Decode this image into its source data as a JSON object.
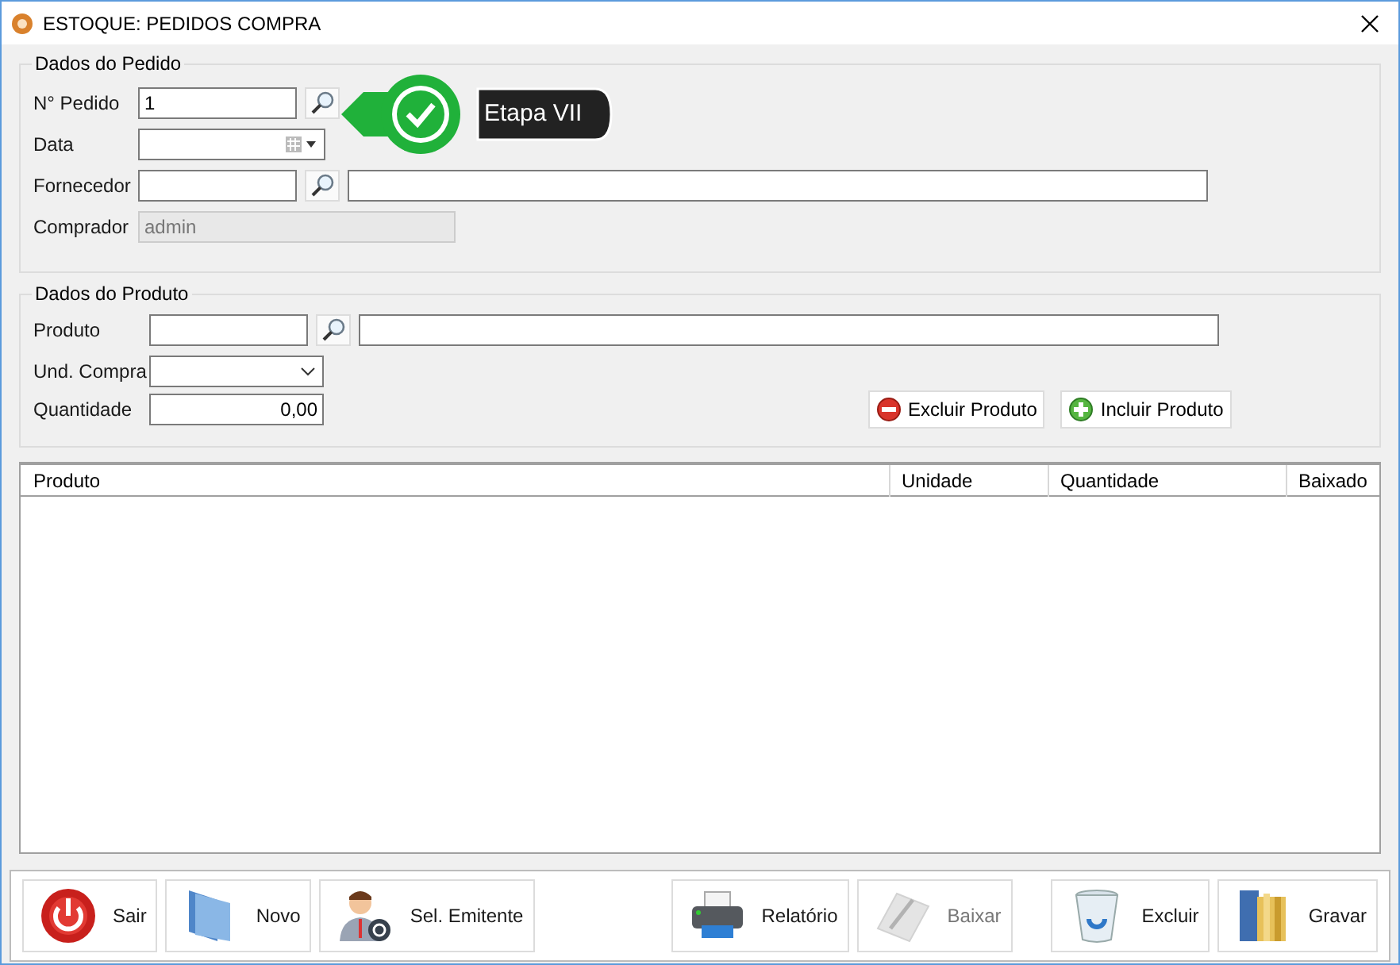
{
  "window": {
    "title": "ESTOQUE: PEDIDOS COMPRA"
  },
  "pedido": {
    "legend": "Dados do Pedido",
    "fields": [
      {
        "label": "N° Pedido",
        "kind": "lookup",
        "value": "1",
        "disabled": false
      },
      {
        "label": "Data",
        "kind": "date",
        "disabled": false
      },
      {
        "label": "Fornecedor",
        "kind": "lookup_desc",
        "disabled": false
      },
      {
        "label": "Comprador",
        "kind": "text",
        "value": "admin",
        "disabled": true
      }
    ]
  },
  "produto": {
    "legend": "Dados do Produto",
    "fields": [
      {
        "label": "Produto",
        "kind": "lookup_desc",
        "disabled": false
      },
      {
        "label": "Und. Compra",
        "kind": "select",
        "disabled": false
      },
      {
        "label": "Quantidade",
        "kind": "number",
        "value": "0,00",
        "disabled": false
      }
    ],
    "actions": [
      {
        "label": "Excluir Produto",
        "kind": "remove"
      },
      {
        "label": "Incluir Produto",
        "kind": "add"
      }
    ]
  },
  "table": {
    "columns": [
      "Produto",
      "Unidade",
      "Quantidade",
      "Baixado"
    ]
  },
  "callout": {
    "label": "Etapa VII"
  },
  "toolbar": {
    "left": [
      {
        "label": "Sair",
        "kind": "power",
        "disabled": false
      },
      {
        "label": "Novo",
        "kind": "folder",
        "disabled": false
      },
      {
        "label": "Sel. Emitente",
        "kind": "person",
        "disabled": false
      }
    ],
    "middle": [
      {
        "label": "Relatório",
        "kind": "printer",
        "disabled": false
      },
      {
        "label": "Baixar",
        "kind": "pen",
        "disabled": true
      }
    ],
    "right": [
      {
        "label": "Excluir",
        "kind": "trash",
        "disabled": false
      },
      {
        "label": "Gravar",
        "kind": "binder",
        "disabled": false
      }
    ]
  }
}
